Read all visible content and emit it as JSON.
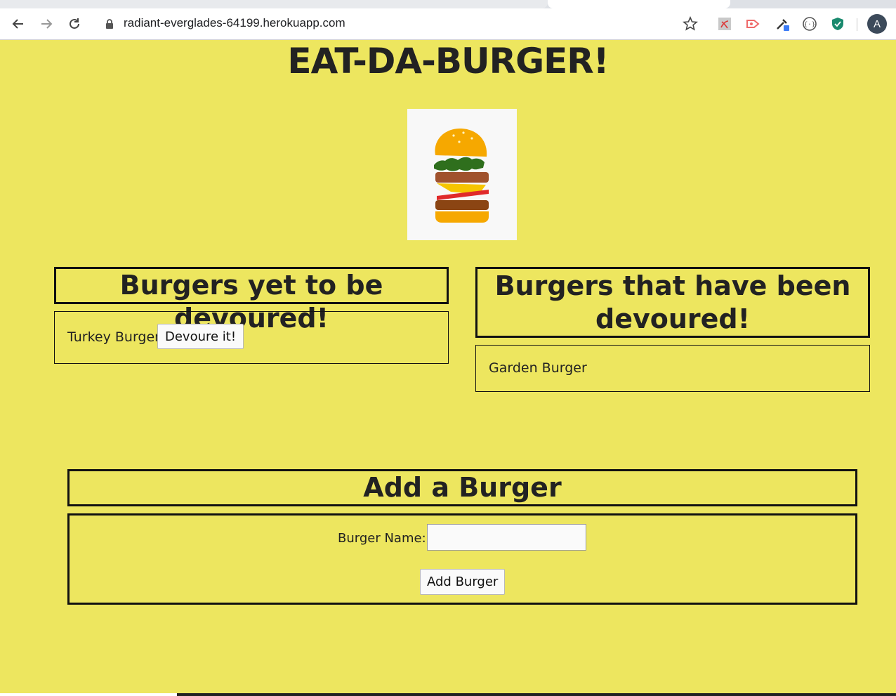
{
  "browser": {
    "url": "radiant-everglades-64199.herokuapp.com",
    "profile_initial": "A",
    "icons": [
      "back-icon",
      "forward-icon",
      "reload-icon",
      "lock-icon",
      "star-icon",
      "pdf-extension-icon",
      "cast-extension-icon",
      "eyedropper-extension-icon",
      "json-extension-icon",
      "shield-extension-icon"
    ]
  },
  "page": {
    "title": "EAT-DA-BURGER!",
    "background_color": "#ede65f"
  },
  "undevoured": {
    "heading": "Burgers yet to be devoured!",
    "items": [
      {
        "name": "Turkey Burger",
        "button": "Devoure it!"
      }
    ]
  },
  "devoured": {
    "heading": "Burgers that have been devoured!",
    "items": [
      {
        "name": "Garden Burger"
      }
    ]
  },
  "add_form": {
    "heading": "Add a Burger",
    "label": "Burger Name:",
    "input_value": "",
    "submit_label": "Add Burger"
  }
}
